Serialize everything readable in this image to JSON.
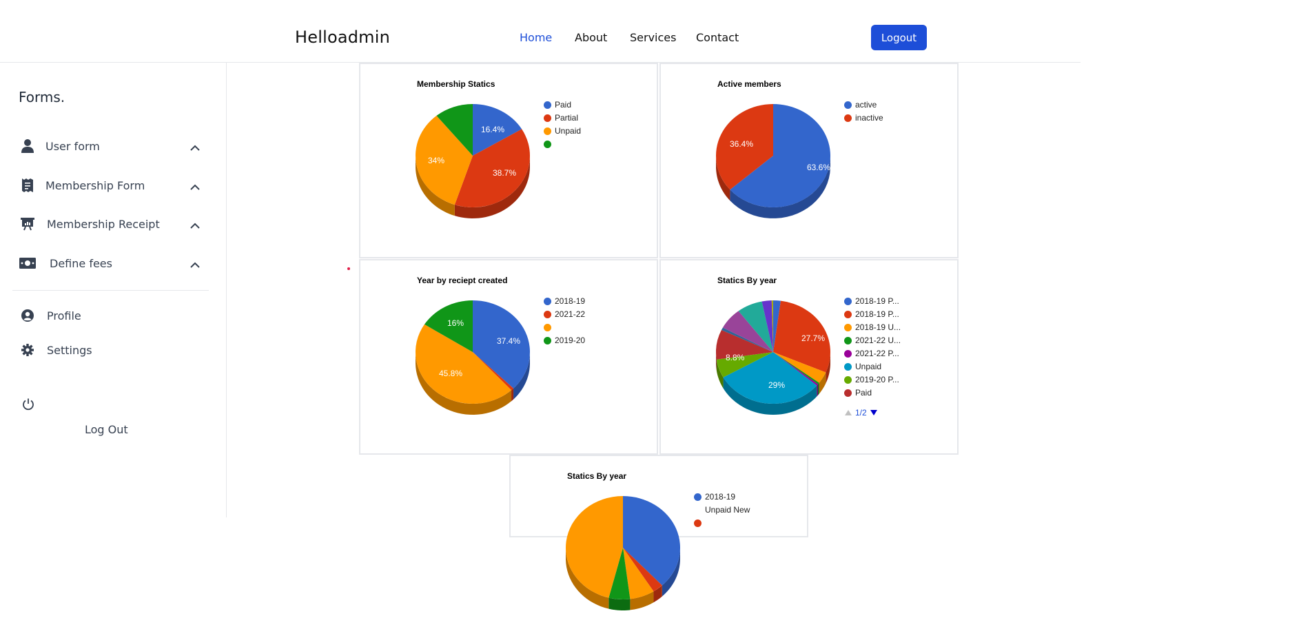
{
  "header": {
    "brand": "Helloadmin",
    "nav": [
      "Home",
      "About",
      "Services",
      "Contact"
    ],
    "logout_label": "Logout"
  },
  "sidebar": {
    "title": "Forms.",
    "items": [
      {
        "label": "User form",
        "icon": "user-icon"
      },
      {
        "label": "Membership Form",
        "icon": "receipt-icon"
      },
      {
        "label": "Membership Receipt",
        "icon": "presentation-icon"
      },
      {
        "label": "Define fees",
        "icon": "money-icon"
      }
    ],
    "bottom": [
      {
        "label": "Profile",
        "icon": "user-circle-icon"
      },
      {
        "label": "Settings",
        "icon": "gear-icon"
      }
    ],
    "logout_label": "Log Out"
  },
  "charts": {
    "c1": {
      "title": "Membership Statics",
      "legend": [
        "Paid",
        "Partial",
        "Unpaid",
        ""
      ],
      "labels": [
        "16.4%",
        "38.7%",
        "34%"
      ]
    },
    "c2": {
      "title": "Active members",
      "legend": [
        "active",
        "inactive"
      ],
      "labels": [
        "63.6%",
        "36.4%"
      ]
    },
    "c3": {
      "title": "Year by reciept created",
      "legend": [
        "2018-19",
        "2021-22",
        "",
        "2019-20"
      ],
      "labels": [
        "37.4%",
        "45.8%",
        "16%"
      ]
    },
    "c4": {
      "title": "Statics By year",
      "legend": [
        "2018-19 P...",
        "2018-19 P...",
        "2018-19 U...",
        "2021-22 U...",
        "2021-22 P...",
        "Unpaid",
        "2019-20 P...",
        "Paid"
      ],
      "labels": [
        "27.7%",
        "29%",
        "8.8%"
      ],
      "pager": "1/2"
    },
    "c5": {
      "title": "Statics By year",
      "legend": [
        "2018-19",
        "Unpaid New"
      ]
    }
  },
  "chart_data": [
    {
      "type": "pie",
      "title": "Membership Statics",
      "categories": [
        "Paid",
        "Partial",
        "Unpaid",
        ""
      ],
      "values": [
        16.4,
        38.7,
        34.0,
        10.9
      ],
      "colors": [
        "#3366cc",
        "#dc3912",
        "#ff9900",
        "#109618"
      ]
    },
    {
      "type": "pie",
      "title": "Active members",
      "categories": [
        "active",
        "inactive"
      ],
      "values": [
        63.6,
        36.4
      ],
      "colors": [
        "#3366cc",
        "#dc3912"
      ]
    },
    {
      "type": "pie",
      "title": "Year by reciept created",
      "categories": [
        "2018-19",
        "2021-22",
        "",
        "2019-20"
      ],
      "values": [
        37.4,
        0.8,
        45.8,
        16.0
      ],
      "colors": [
        "#3366cc",
        "#dc3912",
        "#ff9900",
        "#109618"
      ]
    },
    {
      "type": "pie",
      "title": "Statics By year",
      "categories": [
        "2018-19 P...",
        "2018-19 P...",
        "2018-19 U...",
        "2021-22 U...",
        "2021-22 P...",
        "Unpaid",
        "2019-20 P...",
        "Paid"
      ],
      "values": [
        2.0,
        27.7,
        3.5,
        0.5,
        0.5,
        29.0,
        5.5,
        8.8,
        0.8,
        6.4,
        6.8,
        2.6,
        0.4
      ],
      "colors": [
        "#3366cc",
        "#dc3912",
        "#ff9900",
        "#109618",
        "#990099",
        "#0099c6",
        "#66aa00",
        "#b82e2e",
        "#316395",
        "#994499",
        "#22aa99",
        "#6633cc",
        "#aaaa11"
      ]
    }
  ],
  "colors": {
    "accent": "#1d4ed8",
    "red_dot": "#e11d48"
  }
}
